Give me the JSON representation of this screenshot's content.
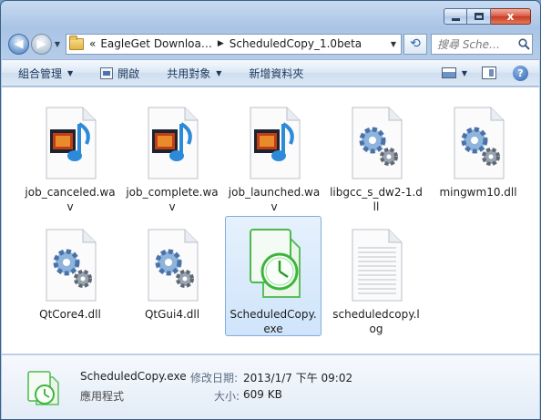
{
  "window": {
    "close_label": "x"
  },
  "nav": {
    "back_glyph": "◀",
    "forward_glyph": "▶",
    "breadcrumb_prefix": "«",
    "breadcrumbs": [
      "EagleGet Downloa…",
      "ScheduledCopy_1.0beta"
    ],
    "search_placeholder": "搜尋 Sche…",
    "refresh_glyph": "⟲"
  },
  "toolbar": {
    "organize": "組合管理",
    "open": "開啟",
    "share_with": "共用對象",
    "new_folder": "新增資料夾",
    "help_glyph": "?"
  },
  "files": [
    {
      "name": "job_canceled.wav",
      "type": "wav"
    },
    {
      "name": "job_complete.wav",
      "type": "wav"
    },
    {
      "name": "job_launched.wav",
      "type": "wav"
    },
    {
      "name": "libgcc_s_dw2-1.dll",
      "type": "dll"
    },
    {
      "name": "mingwm10.dll",
      "type": "dll"
    },
    {
      "name": "QtCore4.dll",
      "type": "dll"
    },
    {
      "name": "QtGui4.dll",
      "type": "dll"
    },
    {
      "name": "ScheduledCopy.exe",
      "type": "exe",
      "selected": true
    },
    {
      "name": "scheduledcopy.log",
      "type": "log"
    }
  ],
  "details": {
    "name": "ScheduledCopy.exe",
    "type": "應用程式",
    "modified_label": "修改日期:",
    "modified_value": "2013/1/7 下午 09:02",
    "size_label": "大小:",
    "size_value": "609 KB"
  },
  "colors": {
    "selection": "#cfe4fb",
    "accent": "#2e63ab"
  }
}
